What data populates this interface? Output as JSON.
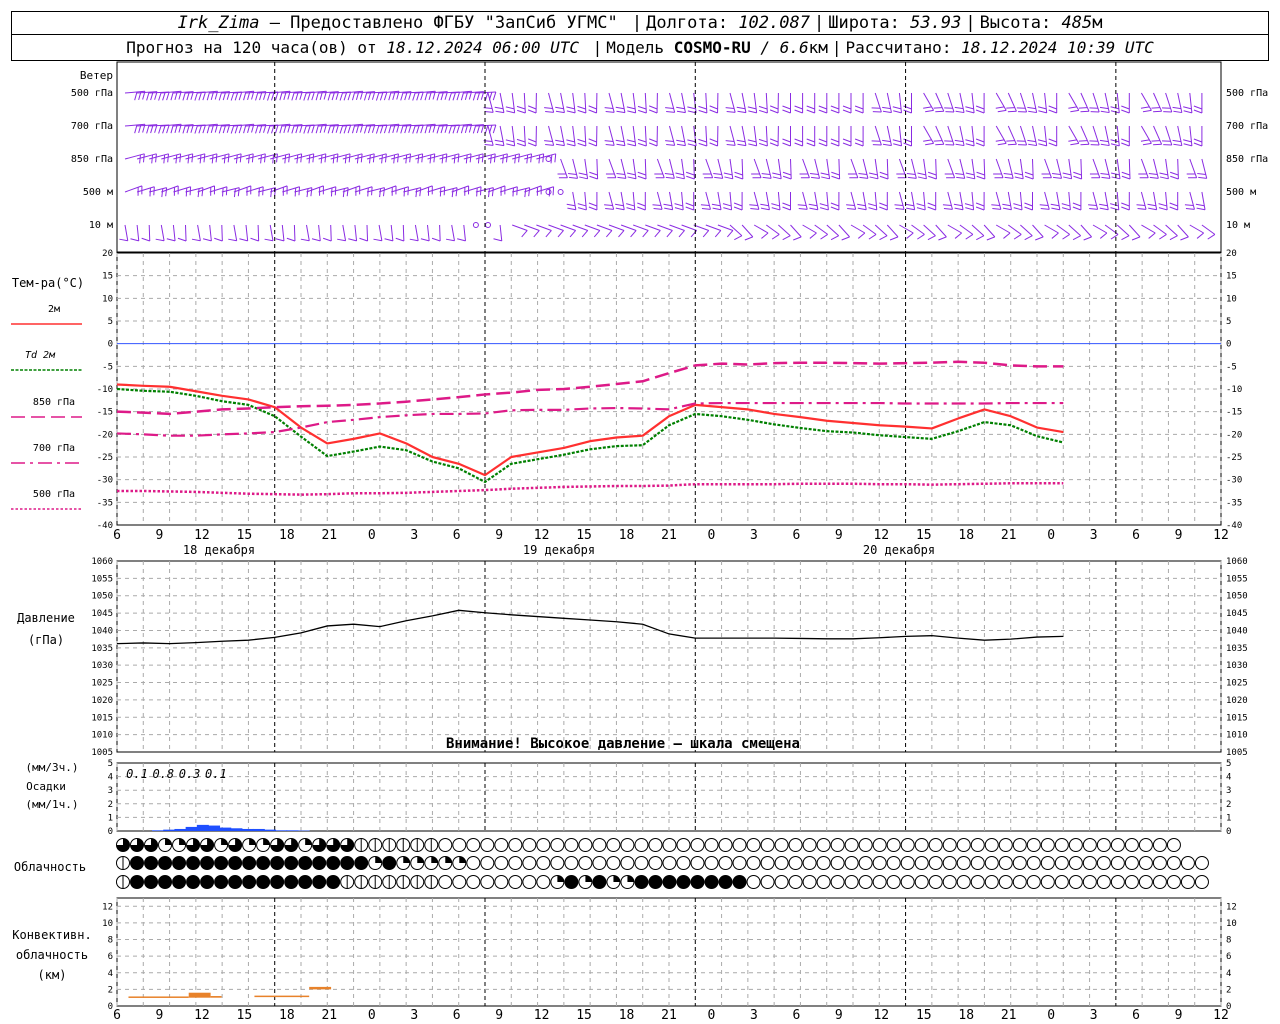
{
  "header": {
    "station": "Irk_Zima",
    "provider": " – Предоставлено ФГБУ \"ЗапСиб УГМС\" ",
    "lon_label": "Долгота:",
    "lon": "102.087",
    "lat_label": "Широта:",
    "lat": "53.93",
    "alt_label": "Высота:",
    "alt": "485",
    "alt_unit": "м",
    "forecast_label": "Прогноз на 120 часа(ов) от",
    "forecast_from": "18.12.2024 06:00 UTC",
    "model_label": "Модель",
    "model": "COSMO-RU",
    "model_res": "/ 6.6",
    "model_res_unit": "км",
    "calc_label": "Рассчитано:",
    "calc_time": "18.12.2024 10:39 UTC"
  },
  "axis": {
    "hour_ticks": [
      "6",
      "9",
      "12",
      "15",
      "18",
      "21",
      "0",
      "3",
      "6",
      "9",
      "12",
      "15",
      "18",
      "21",
      "0",
      "3",
      "6",
      "9",
      "12",
      "15",
      "18",
      "21",
      "0",
      "3",
      "6",
      "9",
      "12"
    ],
    "days": [
      "18 декабря",
      "19 декабря",
      "20 декабря"
    ]
  },
  "wind_panel": {
    "title": "Ветер",
    "levels": [
      "500 гПа",
      "700 гПа",
      "850 гПа",
      "500 м",
      "10 м"
    ],
    "color": "#8a2be2"
  },
  "temp_panel": {
    "title": "Тем-ра(°C)",
    "legend": [
      {
        "label": "2м",
        "color": "#ff3030",
        "style": "solid"
      },
      {
        "label": "Td 2м",
        "color": "#008000",
        "style": "dotted"
      },
      {
        "label": "850 гПа",
        "color": "#dd1a88",
        "style": "dash"
      },
      {
        "label": "700 гПа",
        "color": "#dd1a88",
        "style": "dashdot"
      },
      {
        "label": "500 гПа",
        "color": "#dd1a88",
        "style": "dot"
      }
    ],
    "ticks": [
      "20",
      "15",
      "10",
      "5",
      "0",
      "-5",
      "-10",
      "-15",
      "-20",
      "-25",
      "-30",
      "-35",
      "-40"
    ]
  },
  "pressure_panel": {
    "title1": "Давление",
    "title2": "(гПа)",
    "ticks": [
      "1060",
      "1055",
      "1050",
      "1045",
      "1040",
      "1035",
      "1030",
      "1025",
      "1020",
      "1015",
      "1010",
      "1005"
    ],
    "warning": "Внимание! Высокое давление – шкала смещена"
  },
  "precip_panel": {
    "title1": "(мм/3ч.)",
    "title2": "Осадки",
    "title3": "(мм/1ч.)",
    "ticks": [
      "5",
      "4",
      "3",
      "2",
      "1",
      "0"
    ],
    "amounts": [
      "0.1",
      "0.8",
      "0.3",
      "0.1"
    ]
  },
  "cloud_panel": {
    "title": "Облачность"
  },
  "conv_panel": {
    "title1": "Конвективн.",
    "title2": "облачность",
    "title3": "(км)",
    "ticks": [
      "12",
      "10",
      "8",
      "6",
      "4",
      "2",
      "0"
    ]
  },
  "chart_data": [
    {
      "type": "line",
      "title": "Тем-ра(°C)",
      "x_hours": [
        0,
        3,
        6,
        9,
        12,
        15,
        18,
        21,
        24,
        27,
        30,
        33,
        36,
        39,
        42,
        45,
        48,
        51,
        54,
        57,
        60,
        63,
        66,
        69,
        72,
        75,
        78,
        81,
        84,
        87,
        90,
        93,
        96,
        99,
        102,
        105,
        108,
        111,
        114,
        117,
        120,
        123,
        126
      ],
      "ylim": [
        -40,
        20
      ],
      "series": [
        {
          "name": "2м",
          "values": [
            -9,
            -9.3,
            -9.5,
            -10.5,
            -11.5,
            -12.3,
            -14,
            -18.5,
            -22,
            -21,
            -19.8,
            -22,
            -25,
            -26.5,
            -29,
            -25,
            -24,
            -23,
            -21.5,
            -20.7,
            -20.3,
            -16,
            -13.5,
            -14,
            -14.5,
            -15.5,
            -16.2,
            -17,
            -17.5,
            -18,
            -18.3,
            -18.7,
            -16.5,
            -14.5,
            -16,
            -18.5,
            -19.5
          ]
        },
        {
          "name": "Td 2м",
          "values": [
            -10,
            -10.4,
            -10.6,
            -11.5,
            -12.7,
            -13.5,
            -16,
            -20.5,
            -24.8,
            -23.8,
            -22.7,
            -23.5,
            -26,
            -27.5,
            -30.5,
            -26.5,
            -25.5,
            -24.5,
            -23.3,
            -22.6,
            -22.4,
            -18,
            -15.5,
            -16,
            -16.8,
            -17.8,
            -18.6,
            -19.3,
            -19.6,
            -20.2,
            -20.6,
            -21,
            -19.3,
            -17.3,
            -18,
            -20.4,
            -21.8
          ]
        },
        {
          "name": "850 гПа",
          "values": [
            -15,
            -15.2,
            -15.5,
            -15,
            -14.5,
            -14.3,
            -14,
            -13.8,
            -13.7,
            -13.5,
            -13.2,
            -12.8,
            -12.3,
            -11.8,
            -11.2,
            -10.8,
            -10.2,
            -10,
            -9.5,
            -8.9,
            -8.3,
            -6.5,
            -4.8,
            -4.4,
            -4.6,
            -4.3,
            -4.2,
            -4.2,
            -4.3,
            -4.4,
            -4.3,
            -4.2,
            -4,
            -4.2,
            -4.8,
            -5,
            -5
          ]
        },
        {
          "name": "700 гПа",
          "values": [
            -19.8,
            -20,
            -20.3,
            -20.3,
            -20,
            -19.8,
            -19.5,
            -18.5,
            -17.3,
            -16.8,
            -16.2,
            -15.8,
            -15.5,
            -15.5,
            -15.4,
            -14.7,
            -14.6,
            -14.6,
            -14.3,
            -14.2,
            -14.3,
            -14.5,
            -13.2,
            -13.1,
            -13.1,
            -13.1,
            -13.1,
            -13.1,
            -13.1,
            -13.1,
            -13.2,
            -13.2,
            -13.2,
            -13.2,
            -13.1,
            -13.1,
            -13.1
          ]
        },
        {
          "name": "500 гПа",
          "values": [
            -32.5,
            -32.5,
            -32.6,
            -32.7,
            -32.9,
            -33.1,
            -33.2,
            -33.3,
            -33.2,
            -33,
            -33,
            -32.9,
            -32.7,
            -32.5,
            -32.3,
            -32,
            -31.8,
            -31.6,
            -31.5,
            -31.4,
            -31.4,
            -31.3,
            -31,
            -31,
            -31,
            -31,
            -30.9,
            -30.9,
            -30.9,
            -31,
            -31,
            -31.1,
            -31,
            -30.9,
            -30.8,
            -30.8,
            -30.8
          ]
        }
      ]
    },
    {
      "type": "line",
      "title": "Давление (гПа)",
      "x_hours": [
        0,
        3,
        6,
        9,
        12,
        15,
        18,
        21,
        24,
        27,
        30,
        33,
        36,
        39,
        42,
        45,
        48,
        51,
        54,
        57,
        60,
        63,
        66,
        69,
        72,
        75,
        78,
        81,
        84,
        87,
        90,
        93,
        96,
        99,
        102,
        105,
        108,
        111,
        114,
        117,
        120,
        123,
        126
      ],
      "ylim": [
        1005,
        1060
      ],
      "series": [
        {
          "name": "Давление",
          "values": [
            1036.2,
            1036.4,
            1036.2,
            1036.5,
            1036.9,
            1037.2,
            1038,
            1039.3,
            1041.3,
            1041.8,
            1041.1,
            1042.8,
            1044.2,
            1045.8,
            1045.1,
            1044.5,
            1044,
            1043.5,
            1043,
            1042.5,
            1041.8,
            1039,
            1037.8,
            1037.8,
            1037.8,
            1037.8,
            1037.7,
            1037.6,
            1037.6,
            1037.9,
            1038.3,
            1038.5,
            1037.8,
            1037.2,
            1037.5,
            1038.1,
            1038.3
          ]
        }
      ]
    },
    {
      "type": "bar",
      "title": "Осадки",
      "x_hours": [
        0,
        3,
        6,
        9,
        12,
        15,
        18,
        21,
        24,
        27,
        30,
        33,
        36,
        39,
        42,
        45,
        48,
        51,
        54,
        57,
        60,
        63,
        66,
        69,
        72,
        75,
        78,
        81,
        84,
        87,
        90,
        93,
        96,
        99,
        102,
        105,
        108,
        111,
        114,
        117,
        120,
        123,
        126
      ],
      "ylim": [
        0,
        5
      ],
      "values": [
        0.1,
        0.8,
        0.3,
        0.1,
        0,
        0,
        0,
        0,
        0,
        0,
        0,
        0,
        0,
        0,
        0,
        0,
        0,
        0,
        0,
        0,
        0,
        0,
        0,
        0,
        0,
        0,
        0,
        0,
        0,
        0,
        0,
        0,
        0,
        0,
        0,
        0,
        0,
        0,
        0,
        0,
        0
      ]
    },
    {
      "type": "bar",
      "title": "Конвективн. облачность (км)",
      "x_hours": [
        0,
        3,
        6,
        9,
        12,
        15,
        18,
        21,
        24,
        27,
        30,
        33,
        36,
        39,
        42,
        45,
        48,
        51,
        54,
        57,
        60,
        63,
        66,
        69,
        72,
        75,
        78,
        81,
        84,
        87,
        90,
        93,
        96,
        99,
        102,
        105,
        108,
        111,
        114,
        117,
        120,
        123,
        126
      ],
      "ylim": [
        0,
        13
      ],
      "segments": [
        {
          "from_h": 0.5,
          "to_h": 6,
          "base": 1.0,
          "top": 1.15
        },
        {
          "from_h": 6,
          "to_h": 8,
          "base": 1.0,
          "top": 1.6
        },
        {
          "from_h": 8,
          "to_h": 9,
          "base": 1.0,
          "top": 1.2
        },
        {
          "from_h": 12,
          "to_h": 17,
          "base": 1.1,
          "top": 1.25
        },
        {
          "from_h": 17,
          "to_h": 19,
          "base": 2.0,
          "top": 2.3
        }
      ]
    },
    {
      "type": "table",
      "title": "Облачность",
      "rows": [
        "pppqqppqpqqppqppphhhhhhhhhhhhhhhhhhhhhhhhhhhhhhhhhhhhhhhhhhhhhhhhhhhhhhhhhhh",
        "hfffffffffffffffffqfqqqqqhhhhhhhhhhhhhhhhhhhhhhhhhhhhhhhhhhhhhhhhhhhhhhhhhhhhhh",
        "hfffffffffffffffhhhhhhhhhhhhhhhqfqfqqffffffffhhhhhhhhhhhhhhhhhhhhhhhhhhhhhhhhhh"
      ]
    }
  ]
}
